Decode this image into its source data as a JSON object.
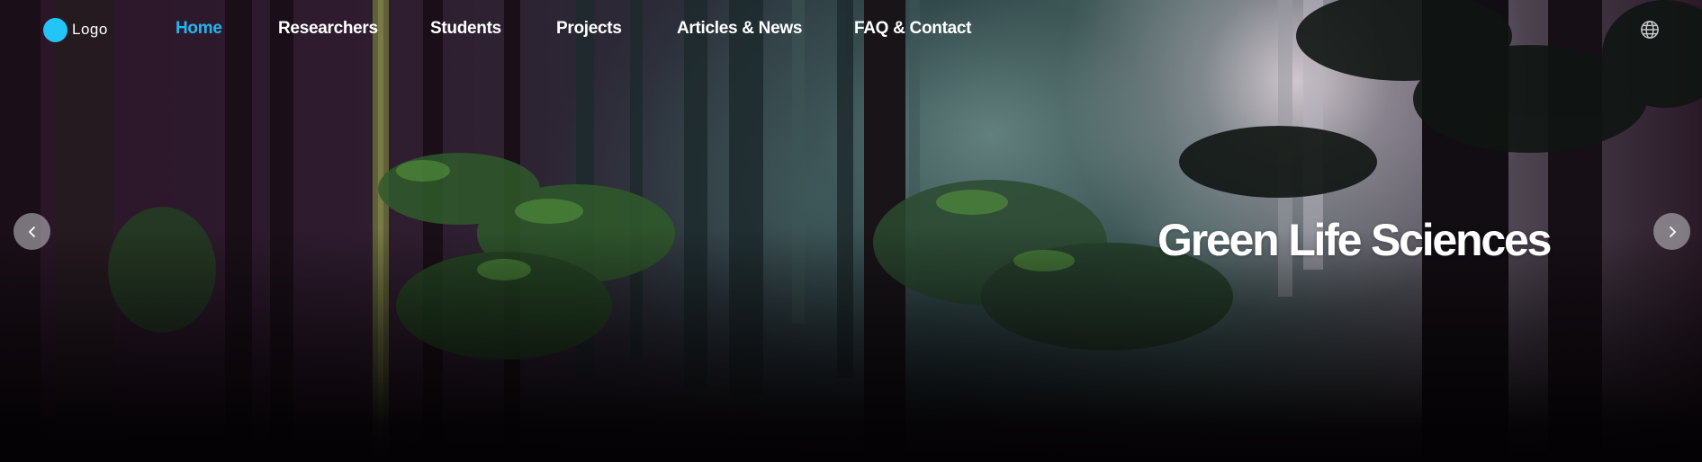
{
  "logo": {
    "text": "Logo",
    "color": "#23c4f7"
  },
  "nav": {
    "items": [
      {
        "label": "Home",
        "active": true
      },
      {
        "label": "Researchers",
        "active": false
      },
      {
        "label": "Students",
        "active": false
      },
      {
        "label": "Projects",
        "active": false
      },
      {
        "label": "Articles & News",
        "active": false
      },
      {
        "label": "FAQ & Contact",
        "active": false
      }
    ],
    "active_color": "#23b6f0",
    "language_icon": "globe-icon"
  },
  "hero": {
    "headline": "Green Life Sciences",
    "prev_icon": "chevron-left-icon",
    "next_icon": "chevron-right-icon"
  }
}
